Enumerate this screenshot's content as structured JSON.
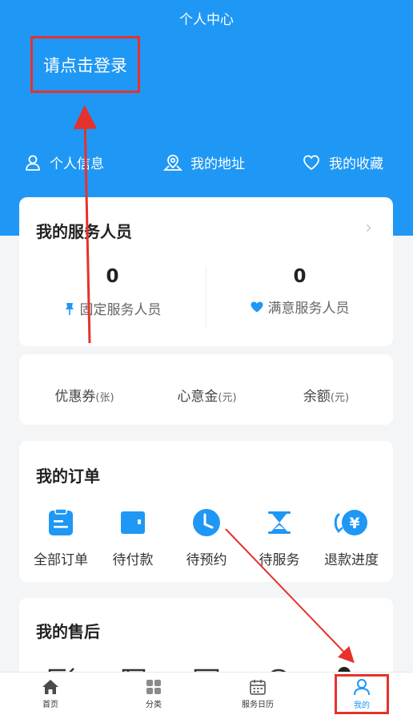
{
  "header": {
    "title": "个人中心",
    "login_label": "请点击登录",
    "quick_links": [
      {
        "label": "个人信息",
        "icon": "user-icon"
      },
      {
        "label": "我的地址",
        "icon": "map-pin-icon"
      },
      {
        "label": "我的收藏",
        "icon": "heart-icon"
      }
    ]
  },
  "staff": {
    "title": "我的服务人员",
    "fixed": {
      "count": "0",
      "label": "固定服务人员",
      "icon": "pin-icon"
    },
    "satisfied": {
      "count": "0",
      "label": "满意服务人员",
      "icon": "heart-filled-icon"
    }
  },
  "balance": [
    {
      "label": "优惠券",
      "unit": "(张)"
    },
    {
      "label": "心意金",
      "unit": "(元)"
    },
    {
      "label": "余额",
      "unit": "(元)"
    }
  ],
  "orders": {
    "title": "我的订单",
    "items": [
      {
        "label": "全部订单",
        "icon": "clipboard-icon"
      },
      {
        "label": "待付款",
        "icon": "wallet-icon"
      },
      {
        "label": "待预约",
        "icon": "clock-icon"
      },
      {
        "label": "待服务",
        "icon": "hourglass-icon"
      },
      {
        "label": "退款进度",
        "icon": "refund-yen-icon"
      }
    ]
  },
  "aftersale": {
    "title": "我的售后"
  },
  "tabbar": [
    {
      "label": "首页",
      "icon": "home-icon"
    },
    {
      "label": "分类",
      "icon": "grid-icon"
    },
    {
      "label": "服务日历",
      "icon": "calendar-icon"
    },
    {
      "label": "我的",
      "icon": "user-icon",
      "active": true
    }
  ],
  "colors": {
    "brand": "#1f97f5",
    "highlight_box": "#e5322d",
    "background": "#f4f5f7"
  }
}
